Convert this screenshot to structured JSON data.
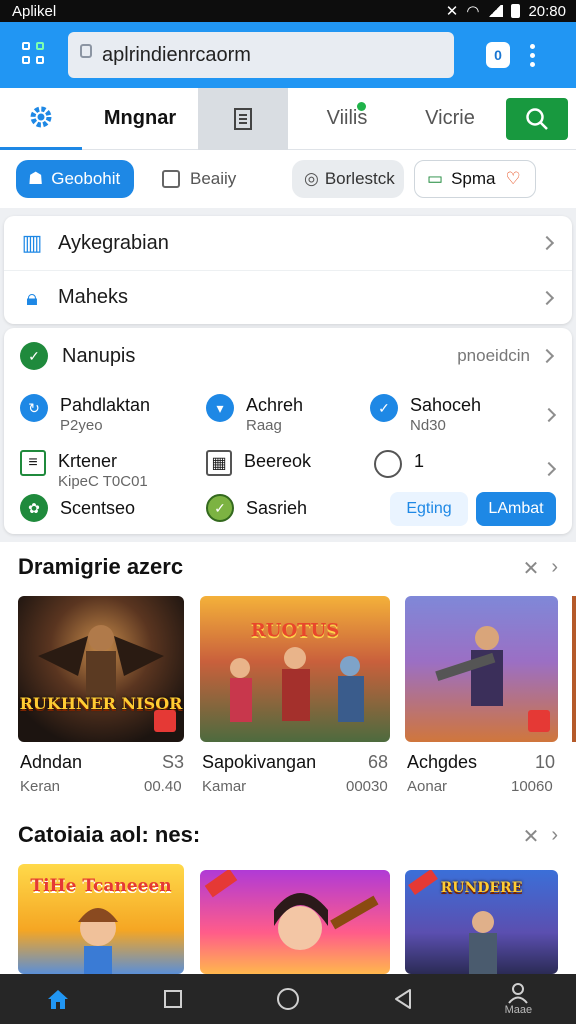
{
  "status": {
    "app_name": "Aplikel",
    "time": "20:80"
  },
  "browser": {
    "url": "aplrindienrcaorm",
    "tab_count": "0"
  },
  "tabs": [
    {
      "label": ""
    },
    {
      "label": "Mngnar"
    },
    {
      "label": ""
    },
    {
      "label": "Viilis"
    },
    {
      "label": "Vicrie"
    }
  ],
  "chips": {
    "geobohit": "Geobohit",
    "beaiiy": "Beaiiy",
    "borlestck": "Borlestck",
    "spma": "Spma"
  },
  "card1": {
    "row1": "Aykegrabian",
    "row2": "Maheks"
  },
  "card2": {
    "title": "Nanupis",
    "link": "pnoeidcin",
    "items": [
      {
        "title": "Pahdlaktan",
        "sub": "P2yeo"
      },
      {
        "title": "Achreh",
        "sub": "Raag"
      },
      {
        "title": "Sahoceh",
        "sub": "Nd30"
      },
      {
        "title": "Krtener",
        "sub": "KipeC T0C01"
      },
      {
        "title": "Beereok",
        "sub": ""
      },
      {
        "title": "1",
        "sub": ""
      },
      {
        "title": "Scentseo",
        "sub": ""
      },
      {
        "title": "Sasrieh",
        "sub": ""
      }
    ],
    "btn_ghost": "Egting",
    "btn_solid": "LAmbat"
  },
  "section1": {
    "title": "Dramigrie azerc",
    "games": [
      {
        "name": "Adndan",
        "sub": "Keran",
        "num": "S3",
        "time": "00.40",
        "logo": "RUKHNER NISOR"
      },
      {
        "name": "Sapokivangan",
        "sub": "Kamar",
        "num": "68",
        "time": "00030",
        "logo": "RUOTUS"
      },
      {
        "name": "Achgdes",
        "sub": "Aonar",
        "num": "10",
        "time": "10060",
        "logo": ""
      }
    ]
  },
  "section2": {
    "title": "Catoiaia aol: nes:",
    "games": [
      {
        "logo": "TiHe Tcaneeen"
      },
      {
        "logo": ""
      },
      {
        "logo": "RUNDERE"
      }
    ]
  },
  "nav": {
    "profile_label": "Maae"
  },
  "colors": {
    "accent": "#2196f3",
    "green": "#18993f",
    "dark": "#262626"
  }
}
